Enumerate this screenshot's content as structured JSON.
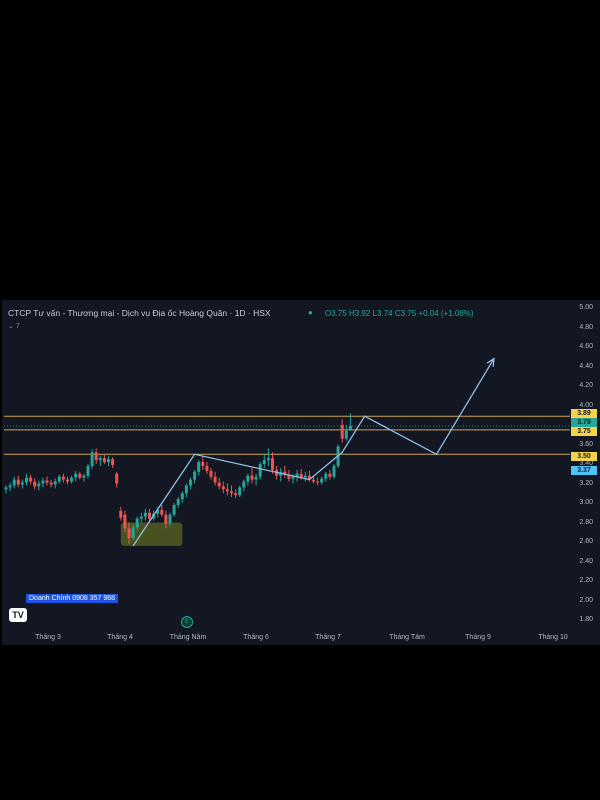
{
  "header": {
    "title": "CTCP Tư vấn - Thương mại - Dịch vụ Địa ốc Hoàng Quân · 1D · HSX",
    "ohlc": "O3.75 H3.92 L3.74 C3.75 +0.04 (+1.08%)",
    "indicator_toggle": "7"
  },
  "contact": "Doanh Chính 0908 357 968",
  "logo_text": "TV",
  "earnings_marker": "E",
  "colors": {
    "background": "#131722",
    "up": "#26a69a",
    "down": "#ef5350",
    "resistance": "#f0c060",
    "projection": "#90bfe8",
    "accumulation_zone": "#6d7a1f"
  },
  "chart_data": {
    "type": "candlestick",
    "x_ticks": [
      "Tháng 3",
      "Tháng 4",
      "Tháng Năm",
      "Tháng 6",
      "Tháng 7",
      "Tháng Tám",
      "Tháng 9",
      "Tháng 10"
    ],
    "y_ticks": [
      5.0,
      4.8,
      4.6,
      4.4,
      4.2,
      4.0,
      3.8,
      3.6,
      3.4,
      3.2,
      3.0,
      2.8,
      2.6,
      2.4,
      2.2,
      2.0,
      1.8
    ],
    "ylim": [
      1.7,
      5.05
    ],
    "price_labels": [
      {
        "value": 3.89,
        "label": "3.89",
        "color": "#f5d34d"
      },
      {
        "value": 3.79,
        "label": "3.79",
        "color": "#26a69a"
      },
      {
        "value": 3.75,
        "label": "3.75",
        "color": "#f5d34d"
      },
      {
        "value": 3.5,
        "label": "3.50",
        "color": "#f5d34d"
      },
      {
        "value": 3.37,
        "label": "3.37",
        "color": "#4fc3f7"
      }
    ],
    "horizontal_lines": [
      3.89,
      3.75,
      3.5
    ],
    "candles": [
      {
        "d": 0,
        "o": 3.14,
        "h": 3.18,
        "l": 3.1,
        "c": 3.16
      },
      {
        "d": 2,
        "o": 3.16,
        "h": 3.21,
        "l": 3.12,
        "c": 3.18
      },
      {
        "d": 4,
        "o": 3.18,
        "h": 3.27,
        "l": 3.15,
        "c": 3.24
      },
      {
        "d": 6,
        "o": 3.24,
        "h": 3.28,
        "l": 3.16,
        "c": 3.19
      },
      {
        "d": 8,
        "o": 3.19,
        "h": 3.24,
        "l": 3.15,
        "c": 3.21
      },
      {
        "d": 10,
        "o": 3.21,
        "h": 3.3,
        "l": 3.18,
        "c": 3.26
      },
      {
        "d": 12,
        "o": 3.26,
        "h": 3.29,
        "l": 3.19,
        "c": 3.22
      },
      {
        "d": 14,
        "o": 3.22,
        "h": 3.25,
        "l": 3.14,
        "c": 3.17
      },
      {
        "d": 16,
        "o": 3.17,
        "h": 3.23,
        "l": 3.13,
        "c": 3.2
      },
      {
        "d": 18,
        "o": 3.2,
        "h": 3.26,
        "l": 3.16,
        "c": 3.23
      },
      {
        "d": 20,
        "o": 3.23,
        "h": 3.27,
        "l": 3.18,
        "c": 3.21
      },
      {
        "d": 22,
        "o": 3.21,
        "h": 3.24,
        "l": 3.16,
        "c": 3.19
      },
      {
        "d": 24,
        "o": 3.19,
        "h": 3.25,
        "l": 3.15,
        "c": 3.22
      },
      {
        "d": 26,
        "o": 3.22,
        "h": 3.29,
        "l": 3.2,
        "c": 3.27
      },
      {
        "d": 28,
        "o": 3.27,
        "h": 3.3,
        "l": 3.21,
        "c": 3.24
      },
      {
        "d": 30,
        "o": 3.24,
        "h": 3.27,
        "l": 3.19,
        "c": 3.22
      },
      {
        "d": 32,
        "o": 3.22,
        "h": 3.28,
        "l": 3.2,
        "c": 3.26
      },
      {
        "d": 34,
        "o": 3.26,
        "h": 3.33,
        "l": 3.22,
        "c": 3.3
      },
      {
        "d": 36,
        "o": 3.3,
        "h": 3.32,
        "l": 3.24,
        "c": 3.26
      },
      {
        "d": 38,
        "o": 3.26,
        "h": 3.3,
        "l": 3.22,
        "c": 3.28
      },
      {
        "d": 40,
        "o": 3.28,
        "h": 3.4,
        "l": 3.25,
        "c": 3.38
      },
      {
        "d": 42,
        "o": 3.38,
        "h": 3.55,
        "l": 3.35,
        "c": 3.52
      },
      {
        "d": 44,
        "o": 3.52,
        "h": 3.56,
        "l": 3.4,
        "c": 3.44
      },
      {
        "d": 46,
        "o": 3.44,
        "h": 3.49,
        "l": 3.38,
        "c": 3.46
      },
      {
        "d": 48,
        "o": 3.46,
        "h": 3.5,
        "l": 3.4,
        "c": 3.42
      },
      {
        "d": 50,
        "o": 3.42,
        "h": 3.48,
        "l": 3.38,
        "c": 3.45
      },
      {
        "d": 52,
        "o": 3.45,
        "h": 3.47,
        "l": 3.36,
        "c": 3.39
      },
      {
        "d": 54,
        "o": 3.3,
        "h": 3.32,
        "l": 3.16,
        "c": 3.2
      },
      {
        "d": 56,
        "o": 2.92,
        "h": 2.96,
        "l": 2.82,
        "c": 2.85
      },
      {
        "d": 58,
        "o": 2.88,
        "h": 2.92,
        "l": 2.7,
        "c": 2.74
      },
      {
        "d": 60,
        "o": 2.74,
        "h": 2.8,
        "l": 2.58,
        "c": 2.64
      },
      {
        "d": 62,
        "o": 2.64,
        "h": 2.78,
        "l": 2.62,
        "c": 2.75
      },
      {
        "d": 64,
        "o": 2.75,
        "h": 2.86,
        "l": 2.72,
        "c": 2.84
      },
      {
        "d": 66,
        "o": 2.84,
        "h": 2.9,
        "l": 2.8,
        "c": 2.86
      },
      {
        "d": 68,
        "o": 2.86,
        "h": 2.94,
        "l": 2.82,
        "c": 2.9
      },
      {
        "d": 70,
        "o": 2.9,
        "h": 2.94,
        "l": 2.8,
        "c": 2.84
      },
      {
        "d": 72,
        "o": 2.84,
        "h": 2.92,
        "l": 2.82,
        "c": 2.89
      },
      {
        "d": 74,
        "o": 2.89,
        "h": 2.96,
        "l": 2.85,
        "c": 2.93
      },
      {
        "d": 76,
        "o": 2.93,
        "h": 2.98,
        "l": 2.86,
        "c": 2.88
      },
      {
        "d": 78,
        "o": 2.88,
        "h": 2.92,
        "l": 2.74,
        "c": 2.79
      },
      {
        "d": 80,
        "o": 2.79,
        "h": 2.9,
        "l": 2.76,
        "c": 2.88
      },
      {
        "d": 82,
        "o": 2.88,
        "h": 3.0,
        "l": 2.86,
        "c": 2.98
      },
      {
        "d": 84,
        "o": 2.98,
        "h": 3.06,
        "l": 2.95,
        "c": 3.04
      },
      {
        "d": 86,
        "o": 3.04,
        "h": 3.12,
        "l": 3.0,
        "c": 3.1
      },
      {
        "d": 88,
        "o": 3.1,
        "h": 3.2,
        "l": 3.06,
        "c": 3.18
      },
      {
        "d": 90,
        "o": 3.18,
        "h": 3.26,
        "l": 3.14,
        "c": 3.24
      },
      {
        "d": 92,
        "o": 3.24,
        "h": 3.34,
        "l": 3.2,
        "c": 3.32
      },
      {
        "d": 94,
        "o": 3.32,
        "h": 3.44,
        "l": 3.28,
        "c": 3.42
      },
      {
        "d": 96,
        "o": 3.42,
        "h": 3.48,
        "l": 3.34,
        "c": 3.38
      },
      {
        "d": 98,
        "o": 3.38,
        "h": 3.42,
        "l": 3.3,
        "c": 3.33
      },
      {
        "d": 100,
        "o": 3.33,
        "h": 3.36,
        "l": 3.24,
        "c": 3.27
      },
      {
        "d": 102,
        "o": 3.27,
        "h": 3.32,
        "l": 3.18,
        "c": 3.21
      },
      {
        "d": 104,
        "o": 3.21,
        "h": 3.26,
        "l": 3.14,
        "c": 3.17
      },
      {
        "d": 106,
        "o": 3.17,
        "h": 3.22,
        "l": 3.1,
        "c": 3.14
      },
      {
        "d": 108,
        "o": 3.14,
        "h": 3.2,
        "l": 3.08,
        "c": 3.12
      },
      {
        "d": 110,
        "o": 3.12,
        "h": 3.18,
        "l": 3.06,
        "c": 3.1
      },
      {
        "d": 112,
        "o": 3.1,
        "h": 3.14,
        "l": 3.05,
        "c": 3.08
      },
      {
        "d": 114,
        "o": 3.08,
        "h": 3.18,
        "l": 3.06,
        "c": 3.16
      },
      {
        "d": 116,
        "o": 3.16,
        "h": 3.24,
        "l": 3.12,
        "c": 3.22
      },
      {
        "d": 118,
        "o": 3.22,
        "h": 3.3,
        "l": 3.18,
        "c": 3.28
      },
      {
        "d": 120,
        "o": 3.28,
        "h": 3.36,
        "l": 3.2,
        "c": 3.24
      },
      {
        "d": 122,
        "o": 3.24,
        "h": 3.3,
        "l": 3.18,
        "c": 3.27
      },
      {
        "d": 124,
        "o": 3.27,
        "h": 3.42,
        "l": 3.24,
        "c": 3.4
      },
      {
        "d": 126,
        "o": 3.4,
        "h": 3.5,
        "l": 3.36,
        "c": 3.44
      },
      {
        "d": 128,
        "o": 3.44,
        "h": 3.56,
        "l": 3.38,
        "c": 3.46
      },
      {
        "d": 130,
        "o": 3.46,
        "h": 3.52,
        "l": 3.3,
        "c": 3.34
      },
      {
        "d": 132,
        "o": 3.34,
        "h": 3.38,
        "l": 3.24,
        "c": 3.28
      },
      {
        "d": 134,
        "o": 3.28,
        "h": 3.36,
        "l": 3.22,
        "c": 3.32
      },
      {
        "d": 136,
        "o": 3.32,
        "h": 3.38,
        "l": 3.26,
        "c": 3.29
      },
      {
        "d": 138,
        "o": 3.29,
        "h": 3.34,
        "l": 3.22,
        "c": 3.25
      },
      {
        "d": 140,
        "o": 3.25,
        "h": 3.3,
        "l": 3.2,
        "c": 3.27
      },
      {
        "d": 142,
        "o": 3.27,
        "h": 3.34,
        "l": 3.22,
        "c": 3.3
      },
      {
        "d": 144,
        "o": 3.3,
        "h": 3.35,
        "l": 3.24,
        "c": 3.26
      },
      {
        "d": 146,
        "o": 3.26,
        "h": 3.32,
        "l": 3.22,
        "c": 3.28
      },
      {
        "d": 148,
        "o": 3.28,
        "h": 3.33,
        "l": 3.22,
        "c": 3.24
      },
      {
        "d": 150,
        "o": 3.24,
        "h": 3.28,
        "l": 3.2,
        "c": 3.22
      },
      {
        "d": 152,
        "o": 3.22,
        "h": 3.26,
        "l": 3.18,
        "c": 3.21
      },
      {
        "d": 154,
        "o": 3.21,
        "h": 3.27,
        "l": 3.19,
        "c": 3.25
      },
      {
        "d": 156,
        "o": 3.25,
        "h": 3.32,
        "l": 3.22,
        "c": 3.3
      },
      {
        "d": 158,
        "o": 3.3,
        "h": 3.34,
        "l": 3.24,
        "c": 3.27
      },
      {
        "d": 160,
        "o": 3.27,
        "h": 3.4,
        "l": 3.25,
        "c": 3.38
      },
      {
        "d": 162,
        "o": 3.38,
        "h": 3.6,
        "l": 3.36,
        "c": 3.58
      },
      {
        "d": 164,
        "o": 3.8,
        "h": 3.86,
        "l": 3.62,
        "c": 3.66
      },
      {
        "d": 166,
        "o": 3.66,
        "h": 3.8,
        "l": 3.64,
        "c": 3.74
      },
      {
        "d": 168,
        "o": 3.75,
        "h": 3.92,
        "l": 3.74,
        "c": 3.79
      }
    ],
    "annotation_lines": [
      [
        {
          "d": 62,
          "p": 2.56
        },
        {
          "d": 92,
          "p": 3.5
        },
        {
          "d": 148,
          "p": 3.24
        },
        {
          "d": 164,
          "p": 3.52
        },
        {
          "d": 175,
          "p": 3.89
        },
        {
          "d": 210,
          "p": 3.5
        },
        {
          "d": 238,
          "p": 4.48
        }
      ]
    ],
    "zone": {
      "d0": 56,
      "d1": 86,
      "p_low": 2.56,
      "p_high": 2.8
    },
    "xlim": [
      0,
      280
    ]
  }
}
